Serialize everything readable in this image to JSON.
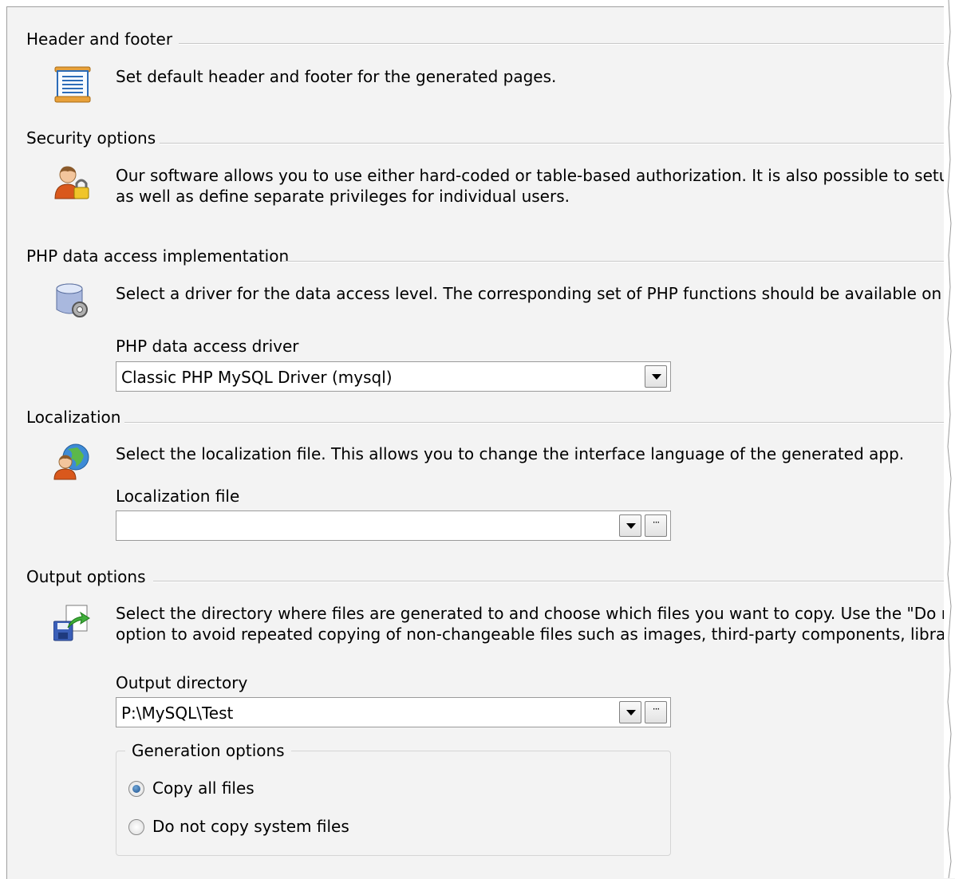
{
  "sections": {
    "header_footer": {
      "title": "Header and footer",
      "icon": "document-icon",
      "description": "Set default header and footer for the generated pages."
    },
    "security": {
      "title": "Security options",
      "icon": "user-lock-icon",
      "description_line1": "Our software allows you to use either hard-coded or table-based authorization.  It is also possible to setup ro",
      "description_line2": "as well as define separate privileges for individual users."
    },
    "php_data_access": {
      "title": "PHP data access implementation",
      "icon": "database-gear-icon",
      "description": "Select a driver for the data access level. The corresponding set of PHP functions should be available on your",
      "driver_label": "PHP data access driver",
      "driver_value": "Classic PHP MySQL Driver (mysql)"
    },
    "localization": {
      "title": "Localization",
      "icon": "globe-user-icon",
      "description": "Select the localization file. This allows you to change the interface language of the generated app.",
      "file_label": "Localization file",
      "file_value": ""
    },
    "output": {
      "title": "Output options",
      "icon": "save-export-icon",
      "description_line1": "Select the directory where files are generated to and choose which files you want to copy. Use the \"Do not c",
      "description_line2": "option to avoid repeated copying of non-changeable files such as images, third-party components, libraries ar",
      "directory_label": "Output directory",
      "directory_value": "P:\\MySQL\\Test",
      "generation": {
        "title": "Generation options",
        "options": [
          {
            "label": "Copy all files",
            "checked": true
          },
          {
            "label": "Do not copy system files",
            "checked": false
          }
        ]
      }
    }
  },
  "browse_label": "···"
}
